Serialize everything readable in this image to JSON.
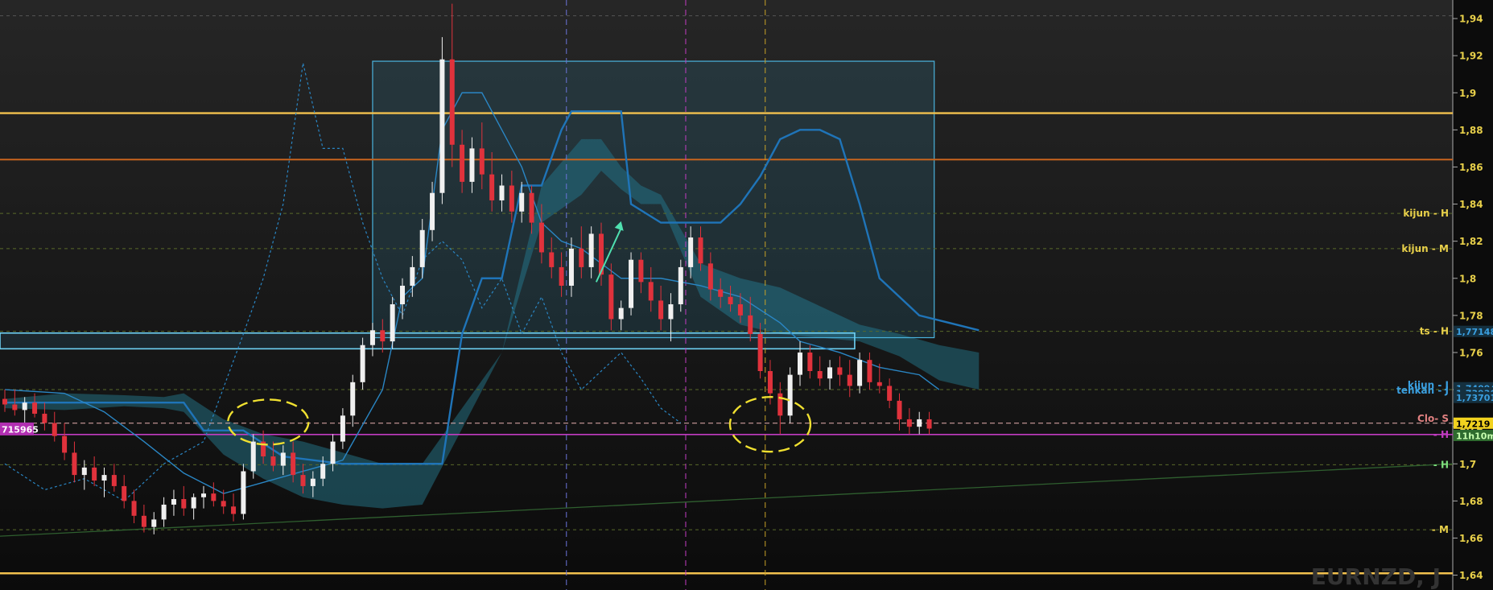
{
  "chart_data": {
    "type": "candlestick",
    "symbol": "EURNZD, J",
    "y_axis": {
      "range": [
        1.632,
        1.95
      ],
      "ticks": [
        "1,94",
        "1,92",
        "1,9",
        "1,88",
        "1,86",
        "1,84",
        "1,82",
        "1,8",
        "1,78",
        "1,76",
        "1,74",
        "1,72",
        "1,7",
        "1,68",
        "1,66",
        "1,64"
      ],
      "tick_values": [
        1.94,
        1.92,
        1.9,
        1.88,
        1.86,
        1.84,
        1.82,
        1.8,
        1.78,
        1.76,
        1.74,
        1.72,
        1.7,
        1.68,
        1.66,
        1.64
      ]
    },
    "x_range": [
      0,
      110
    ],
    "candles": [
      [
        0,
        1.735,
        1.74,
        1.728,
        1.732
      ],
      [
        1,
        1.732,
        1.74,
        1.726,
        1.729
      ],
      [
        2,
        1.729,
        1.736,
        1.722,
        1.733
      ],
      [
        3,
        1.733,
        1.738,
        1.725,
        1.727
      ],
      [
        4,
        1.727,
        1.733,
        1.718,
        1.722
      ],
      [
        5,
        1.722,
        1.728,
        1.712,
        1.715
      ],
      [
        6,
        1.715,
        1.722,
        1.702,
        1.706
      ],
      [
        7,
        1.706,
        1.712,
        1.69,
        1.694
      ],
      [
        8,
        1.694,
        1.702,
        1.686,
        1.698
      ],
      [
        9,
        1.698,
        1.704,
        1.688,
        1.691
      ],
      [
        10,
        1.691,
        1.698,
        1.682,
        1.694
      ],
      [
        11,
        1.694,
        1.7,
        1.685,
        1.688
      ],
      [
        12,
        1.688,
        1.694,
        1.676,
        1.68
      ],
      [
        13,
        1.68,
        1.686,
        1.668,
        1.672
      ],
      [
        14,
        1.672,
        1.678,
        1.663,
        1.666
      ],
      [
        15,
        1.666,
        1.674,
        1.662,
        1.67
      ],
      [
        16,
        1.67,
        1.682,
        1.666,
        1.678
      ],
      [
        17,
        1.678,
        1.686,
        1.672,
        1.681
      ],
      [
        18,
        1.681,
        1.688,
        1.672,
        1.676
      ],
      [
        19,
        1.676,
        1.684,
        1.67,
        1.682
      ],
      [
        20,
        1.682,
        1.688,
        1.676,
        1.684
      ],
      [
        21,
        1.684,
        1.69,
        1.677,
        1.68
      ],
      [
        22,
        1.68,
        1.686,
        1.673,
        1.677
      ],
      [
        23,
        1.677,
        1.684,
        1.669,
        1.673
      ],
      [
        24,
        1.673,
        1.7,
        1.67,
        1.696
      ],
      [
        25,
        1.696,
        1.716,
        1.692,
        1.712
      ],
      [
        26,
        1.712,
        1.718,
        1.7,
        1.704
      ],
      [
        27,
        1.704,
        1.712,
        1.696,
        1.699
      ],
      [
        28,
        1.699,
        1.71,
        1.694,
        1.706
      ],
      [
        29,
        1.706,
        1.712,
        1.69,
        1.694
      ],
      [
        30,
        1.694,
        1.7,
        1.684,
        1.688
      ],
      [
        31,
        1.688,
        1.696,
        1.682,
        1.692
      ],
      [
        32,
        1.692,
        1.704,
        1.688,
        1.7
      ],
      [
        33,
        1.7,
        1.716,
        1.696,
        1.712
      ],
      [
        34,
        1.712,
        1.73,
        1.708,
        1.726
      ],
      [
        35,
        1.726,
        1.748,
        1.72,
        1.744
      ],
      [
        36,
        1.744,
        1.768,
        1.74,
        1.764
      ],
      [
        37,
        1.764,
        1.776,
        1.758,
        1.772
      ],
      [
        38,
        1.772,
        1.778,
        1.76,
        1.766
      ],
      [
        39,
        1.766,
        1.79,
        1.762,
        1.786
      ],
      [
        40,
        1.786,
        1.8,
        1.778,
        1.796
      ],
      [
        41,
        1.796,
        1.812,
        1.79,
        1.806
      ],
      [
        42,
        1.806,
        1.832,
        1.8,
        1.826
      ],
      [
        43,
        1.826,
        1.852,
        1.82,
        1.846
      ],
      [
        44,
        1.846,
        1.93,
        1.84,
        1.918
      ],
      [
        45,
        1.918,
        1.948,
        1.86,
        1.872
      ],
      [
        46,
        1.872,
        1.88,
        1.846,
        1.852
      ],
      [
        47,
        1.852,
        1.876,
        1.846,
        1.87
      ],
      [
        48,
        1.87,
        1.884,
        1.848,
        1.856
      ],
      [
        49,
        1.856,
        1.868,
        1.836,
        1.842
      ],
      [
        50,
        1.842,
        1.856,
        1.836,
        1.85
      ],
      [
        51,
        1.85,
        1.858,
        1.83,
        1.836
      ],
      [
        52,
        1.836,
        1.852,
        1.83,
        1.846
      ],
      [
        53,
        1.846,
        1.85,
        1.824,
        1.83
      ],
      [
        54,
        1.83,
        1.84,
        1.808,
        1.814
      ],
      [
        55,
        1.814,
        1.822,
        1.8,
        1.806
      ],
      [
        56,
        1.806,
        1.814,
        1.79,
        1.796
      ],
      [
        57,
        1.796,
        1.822,
        1.79,
        1.816
      ],
      [
        58,
        1.816,
        1.828,
        1.8,
        1.806
      ],
      [
        59,
        1.806,
        1.828,
        1.8,
        1.824
      ],
      [
        60,
        1.824,
        1.83,
        1.796,
        1.802
      ],
      [
        61,
        1.802,
        1.808,
        1.772,
        1.778
      ],
      [
        62,
        1.778,
        1.788,
        1.772,
        1.784
      ],
      [
        63,
        1.784,
        1.814,
        1.78,
        1.81
      ],
      [
        64,
        1.81,
        1.814,
        1.792,
        1.798
      ],
      [
        65,
        1.798,
        1.806,
        1.782,
        1.788
      ],
      [
        66,
        1.788,
        1.796,
        1.772,
        1.778
      ],
      [
        67,
        1.778,
        1.792,
        1.766,
        1.786
      ],
      [
        68,
        1.786,
        1.81,
        1.782,
        1.806
      ],
      [
        69,
        1.806,
        1.828,
        1.8,
        1.822
      ],
      [
        70,
        1.822,
        1.828,
        1.804,
        1.808
      ],
      [
        71,
        1.808,
        1.814,
        1.788,
        1.794
      ],
      [
        72,
        1.794,
        1.8,
        1.784,
        1.79
      ],
      [
        73,
        1.79,
        1.796,
        1.782,
        1.786
      ],
      [
        74,
        1.786,
        1.792,
        1.776,
        1.78
      ],
      [
        75,
        1.78,
        1.79,
        1.766,
        1.77
      ],
      [
        76,
        1.77,
        1.776,
        1.746,
        1.75
      ],
      [
        77,
        1.75,
        1.756,
        1.732,
        1.738
      ],
      [
        78,
        1.738,
        1.744,
        1.716,
        1.726
      ],
      [
        79,
        1.726,
        1.752,
        1.722,
        1.748
      ],
      [
        80,
        1.748,
        1.766,
        1.742,
        1.76
      ],
      [
        81,
        1.76,
        1.764,
        1.746,
        1.75
      ],
      [
        82,
        1.75,
        1.758,
        1.742,
        1.746
      ],
      [
        83,
        1.746,
        1.756,
        1.74,
        1.752
      ],
      [
        84,
        1.752,
        1.758,
        1.742,
        1.748
      ],
      [
        85,
        1.748,
        1.756,
        1.736,
        1.742
      ],
      [
        86,
        1.742,
        1.76,
        1.738,
        1.756
      ],
      [
        87,
        1.756,
        1.76,
        1.74,
        1.744
      ],
      [
        88,
        1.744,
        1.754,
        1.738,
        1.742
      ],
      [
        89,
        1.742,
        1.746,
        1.73,
        1.734
      ],
      [
        90,
        1.734,
        1.738,
        1.718,
        1.724
      ],
      [
        91,
        1.724,
        1.73,
        1.716,
        1.72
      ],
      [
        92,
        1.72,
        1.728,
        1.716,
        1.724
      ],
      [
        93,
        1.724,
        1.728,
        1.716,
        1.719
      ]
    ],
    "horizontal_lines": [
      {
        "name": "resistance-upper",
        "value": 1.889,
        "color": "#f2c14e",
        "width": 2.4,
        "dash": ""
      },
      {
        "name": "resistance-lower",
        "value": 1.864,
        "color": "#c8641e",
        "width": 2,
        "dash": ""
      },
      {
        "name": "support-bottom",
        "value": 1.641,
        "color": "#f2c14e",
        "width": 2.4,
        "dash": ""
      },
      {
        "name": "close-level",
        "value": 1.7219,
        "color": "#e8b0b0",
        "width": 1,
        "dash": "6,4"
      },
      {
        "name": "magenta-level",
        "value": 1.7158,
        "color": "#c23cc2",
        "width": 1.6,
        "dash": ""
      },
      {
        "name": "kijun-h",
        "value": 1.835,
        "color": "#5a6a2a",
        "width": 1,
        "dash": "4,4"
      },
      {
        "name": "kijun-m",
        "value": 1.816,
        "color": "#5a6a2a",
        "width": 1,
        "dash": "4,4"
      },
      {
        "name": "ts-h",
        "value": 1.7714,
        "color": "#5a6a2a",
        "width": 1,
        "dash": "4,4"
      },
      {
        "name": "kijun-j",
        "value": 1.74,
        "color": "#5a6a2a",
        "width": 1,
        "dash": "4,4"
      },
      {
        "name": "h-level",
        "value": 1.6995,
        "color": "#5a6a2a",
        "width": 1,
        "dash": "4,4"
      },
      {
        "name": "m-level",
        "value": 1.6645,
        "color": "#5a6a2a",
        "width": 1,
        "dash": "4,4"
      },
      {
        "name": "top-dotted",
        "value": 1.9415,
        "color": "#555555",
        "width": 1,
        "dash": "4,4"
      }
    ],
    "vertical_lines": [
      {
        "name": "blue-vline",
        "x": 56.5,
        "color": "#6b74d9"
      },
      {
        "name": "magenta-vline",
        "x": 68.5,
        "color": "#c23cc2"
      },
      {
        "name": "yellow-vline",
        "x": 76.5,
        "color": "#c9a227"
      }
    ],
    "right_labels": [
      {
        "text": "kijun - H",
        "value": 1.835,
        "color": "#e8d04a"
      },
      {
        "text": "kijun - M",
        "value": 1.816,
        "color": "#e8d04a"
      },
      {
        "text": "ts - H",
        "value": 1.7714,
        "color": "#e8d04a"
      },
      {
        "text": "kijun - J",
        "value": 1.7425,
        "color": "#3a9fe0"
      },
      {
        "text": "tenkan - J",
        "value": 1.7395,
        "color": "#3a9fe0"
      },
      {
        "text": "Clo- S",
        "value": 1.7245,
        "color": "#e08080"
      },
      {
        "text": "- H",
        "value": 1.7158,
        "color": "#c23cc2"
      },
      {
        "text": "- H",
        "value": 1.6995,
        "color": "#7ee07e"
      },
      {
        "text": "- M",
        "value": 1.6645,
        "color": "#e8d04a"
      }
    ],
    "price_tags": [
      {
        "text": "1,77148",
        "value": 1.7714,
        "bg": "#15303f",
        "fg": "#3a9fe0"
      },
      {
        "text": "1,74094",
        "value": 1.741,
        "bg": "#15303f",
        "fg": "#3a9fe0"
      },
      {
        "text": "1,73930",
        "value": 1.7383,
        "bg": "#15303f",
        "fg": "#3a9fe0"
      },
      {
        "text": "1,73701",
        "value": 1.7358,
        "bg": "#15303f",
        "fg": "#3a9fe0"
      },
      {
        "text": "1,7219",
        "value": 1.7219,
        "bg": "#f2d21f",
        "fg": "#000000"
      },
      {
        "text": "11h10m",
        "value": 1.7153,
        "bg": "#2e6b2e",
        "fg": "#c8ffb0"
      }
    ],
    "left_tag": {
      "text": "715965",
      "value": 1.7188,
      "bg": "#b12fb1",
      "fg": "#ffffff"
    },
    "arrow_label": "",
    "colors": {
      "up": "#f0f0f0",
      "down": "#e0323c",
      "kijun": "#1f74b8",
      "cloud": "#1f5563",
      "box": "#4ab3dd",
      "background": "#0b0b0b"
    }
  }
}
